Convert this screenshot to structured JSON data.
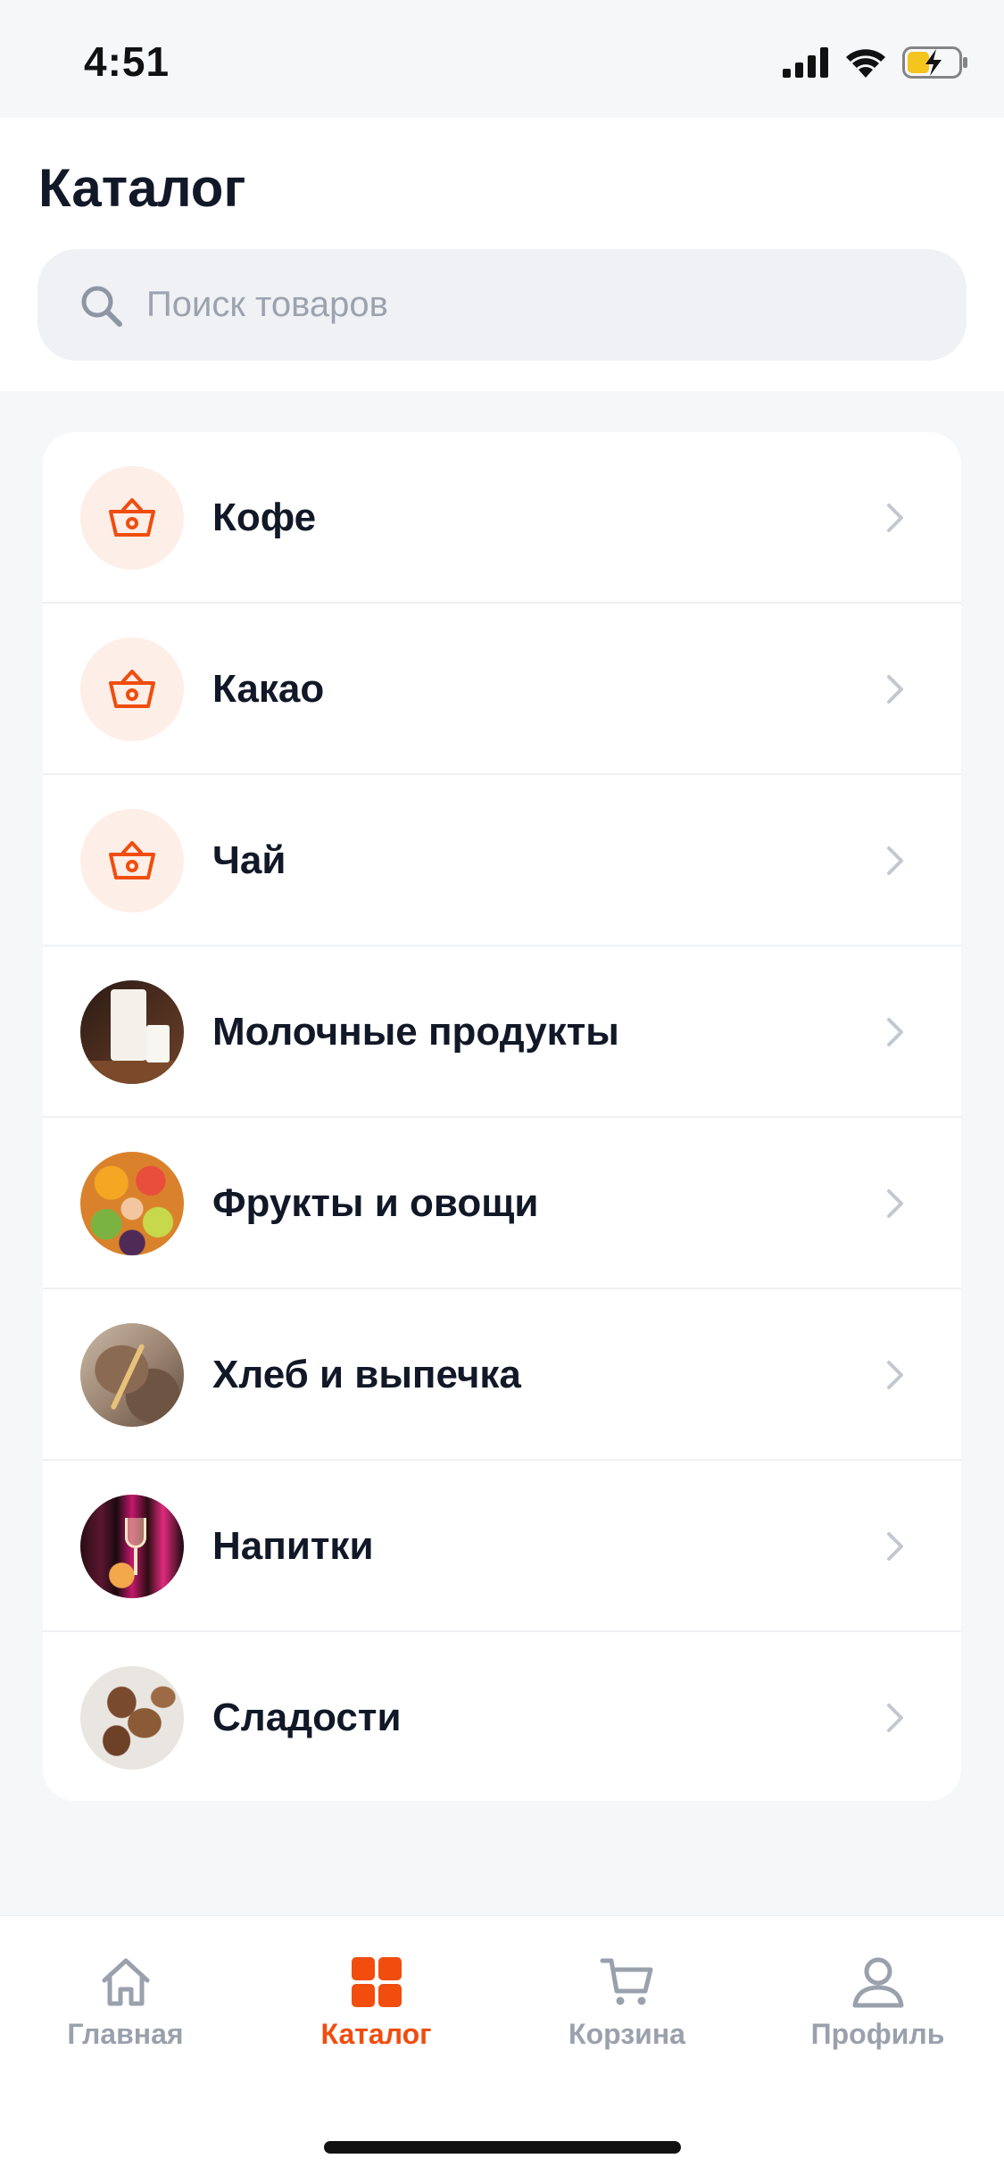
{
  "status_bar": {
    "time": "4:51",
    "icons": [
      "signal-icon",
      "wifi-icon",
      "battery-charging-icon"
    ]
  },
  "header": {
    "title": "Каталог"
  },
  "search": {
    "placeholder": "Поиск товаров",
    "value": "",
    "icon": "search-icon"
  },
  "categories": [
    {
      "label": "Кофе",
      "thumb": "basket-icon"
    },
    {
      "label": "Какао",
      "thumb": "basket-icon"
    },
    {
      "label": "Чай",
      "thumb": "basket-icon"
    },
    {
      "label": "Молочные продукты",
      "thumb": "dairy-photo"
    },
    {
      "label": "Фрукты и овощи",
      "thumb": "fruit-photo"
    },
    {
      "label": "Хлеб и выпечка",
      "thumb": "bread-photo"
    },
    {
      "label": "Напитки",
      "thumb": "drinks-photo"
    },
    {
      "label": "Сладости",
      "thumb": "sweets-photo"
    }
  ],
  "tab_bar": {
    "tabs": [
      {
        "label": "Главная",
        "icon": "home-icon",
        "active": false
      },
      {
        "label": "Каталог",
        "icon": "grid-icon",
        "active": true
      },
      {
        "label": "Корзина",
        "icon": "cart-icon",
        "active": false
      },
      {
        "label": "Профиль",
        "icon": "user-icon",
        "active": false
      }
    ]
  },
  "colors": {
    "accent": "#f04d0f",
    "inactive_tab": "#9aa1ad",
    "icon_bg": "#fdeee7"
  }
}
